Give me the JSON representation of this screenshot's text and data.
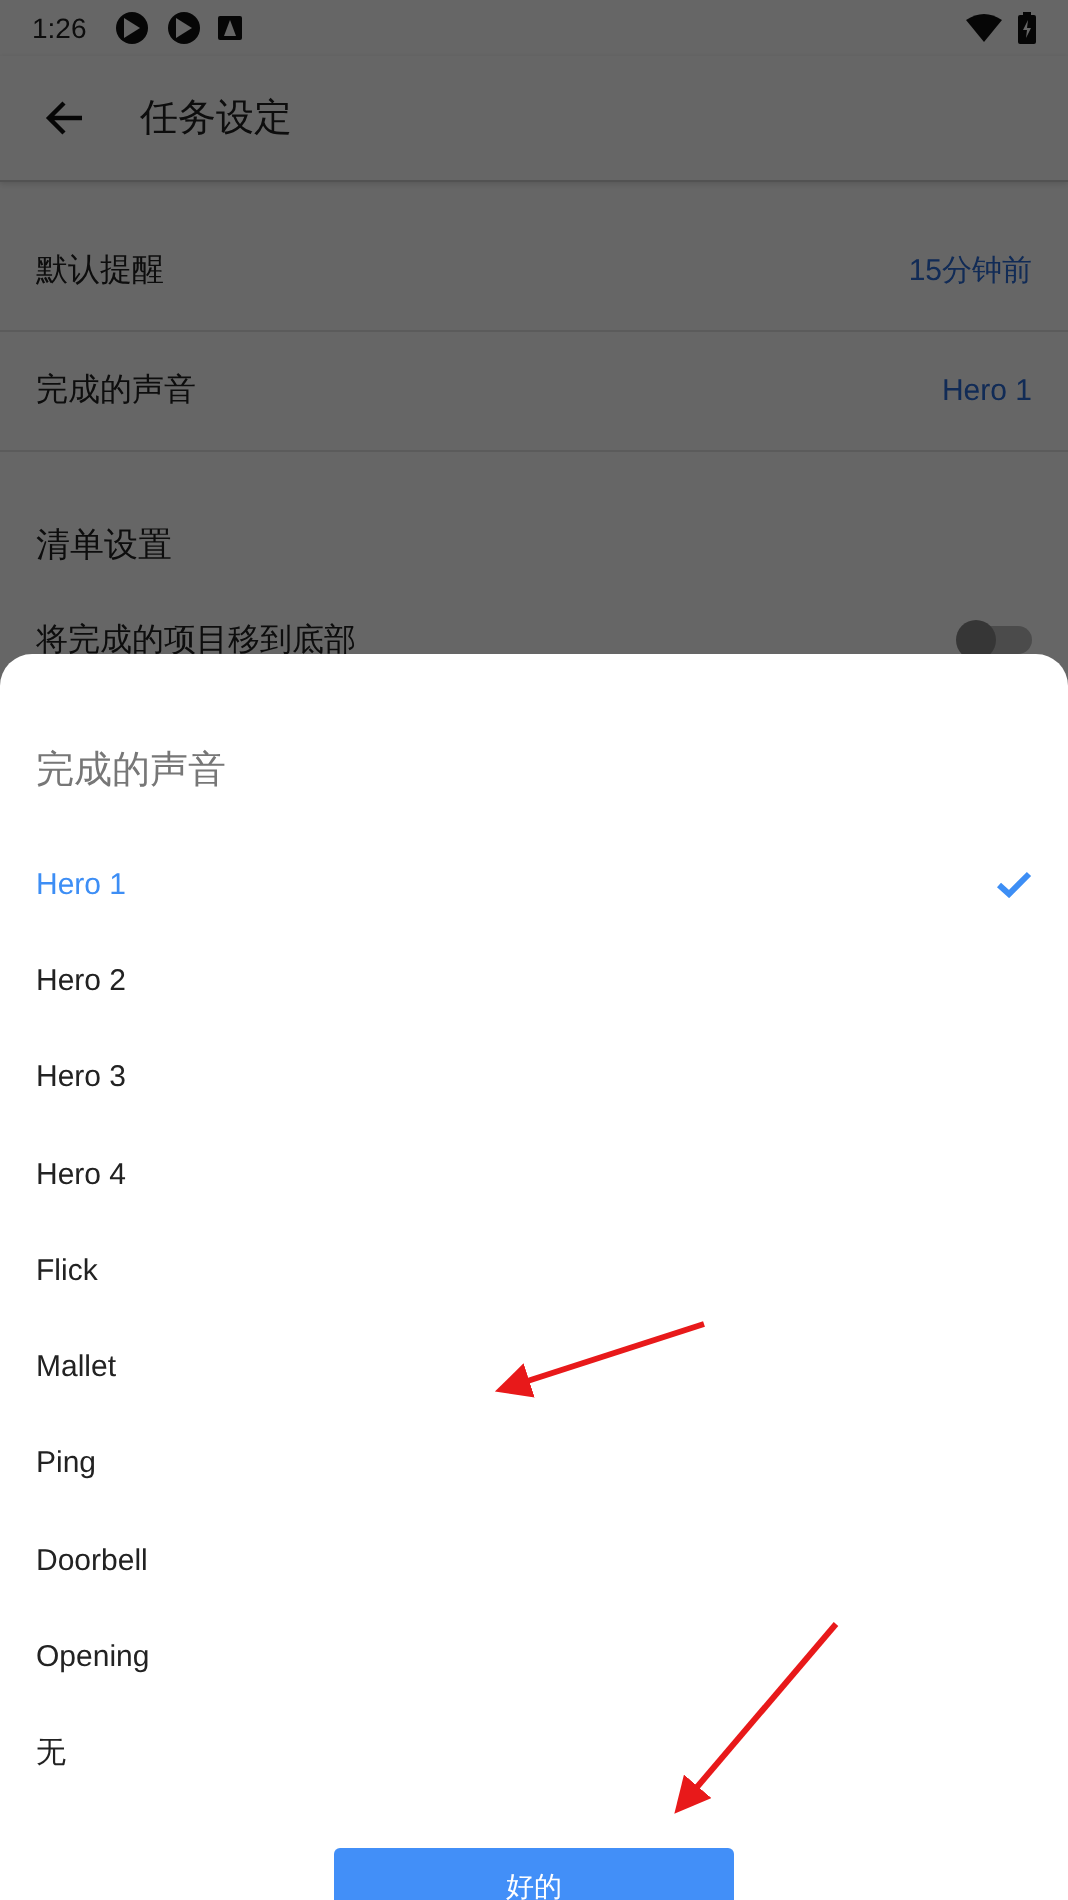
{
  "status_bar": {
    "time": "1:26"
  },
  "app_bar": {
    "title": "任务设定"
  },
  "settings": [
    {
      "label": "默认提醒",
      "value": "15分钟前"
    },
    {
      "label": "完成的声音",
      "value": "Hero 1"
    }
  ],
  "section": {
    "title": "清单设置",
    "rows": [
      {
        "label": "将完成的项目移到底部",
        "on": false
      }
    ]
  },
  "sheet": {
    "title": "完成的声音",
    "options": [
      {
        "label": "Hero 1",
        "selected": true
      },
      {
        "label": "Hero 2",
        "selected": false
      },
      {
        "label": "Hero 3",
        "selected": false
      },
      {
        "label": "Hero 4",
        "selected": false
      },
      {
        "label": "Flick",
        "selected": false
      },
      {
        "label": "Mallet",
        "selected": false
      },
      {
        "label": "Ping",
        "selected": false
      },
      {
        "label": "Doorbell",
        "selected": false
      },
      {
        "label": "Opening",
        "selected": false
      },
      {
        "label": "无",
        "selected": false
      }
    ],
    "button": "好的"
  }
}
